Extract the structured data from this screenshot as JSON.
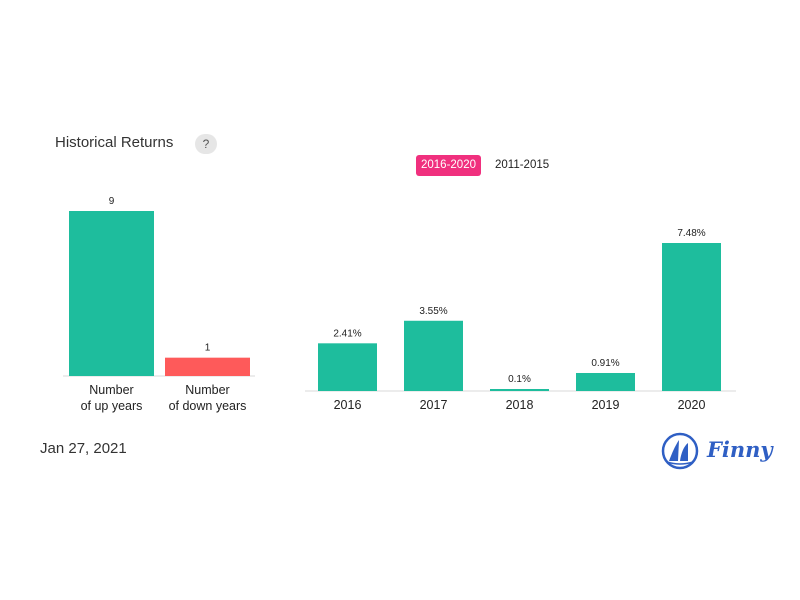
{
  "header": {
    "title": "Historical Returns",
    "help_label": "?"
  },
  "tabs": [
    {
      "label": "2016-2020",
      "active": true
    },
    {
      "label": "2011-2015",
      "active": false
    }
  ],
  "footer": {
    "date": "Jan 27, 2021",
    "brand": "Finny"
  },
  "colors": {
    "up": "#1ebd9d",
    "down": "#fe5a5a",
    "active_tab": "#f0307e",
    "brand": "#2f5fc4"
  },
  "chart_data": [
    {
      "type": "bar",
      "categories": [
        "Number\nof up years",
        "Number\nof down years"
      ],
      "values": [
        9,
        1
      ],
      "data_labels": [
        "9",
        "1"
      ],
      "colors": [
        "#1ebd9d",
        "#fe5a5a"
      ],
      "ylim": [
        0,
        9
      ]
    },
    {
      "type": "bar",
      "categories": [
        "2016",
        "2017",
        "2018",
        "2019",
        "2020"
      ],
      "values": [
        2.41,
        3.55,
        0.1,
        0.91,
        7.48
      ],
      "data_labels": [
        "2.41%",
        "3.55%",
        "0.1%",
        "0.91%",
        "7.48%"
      ],
      "ylim": [
        0,
        7.48
      ]
    }
  ]
}
